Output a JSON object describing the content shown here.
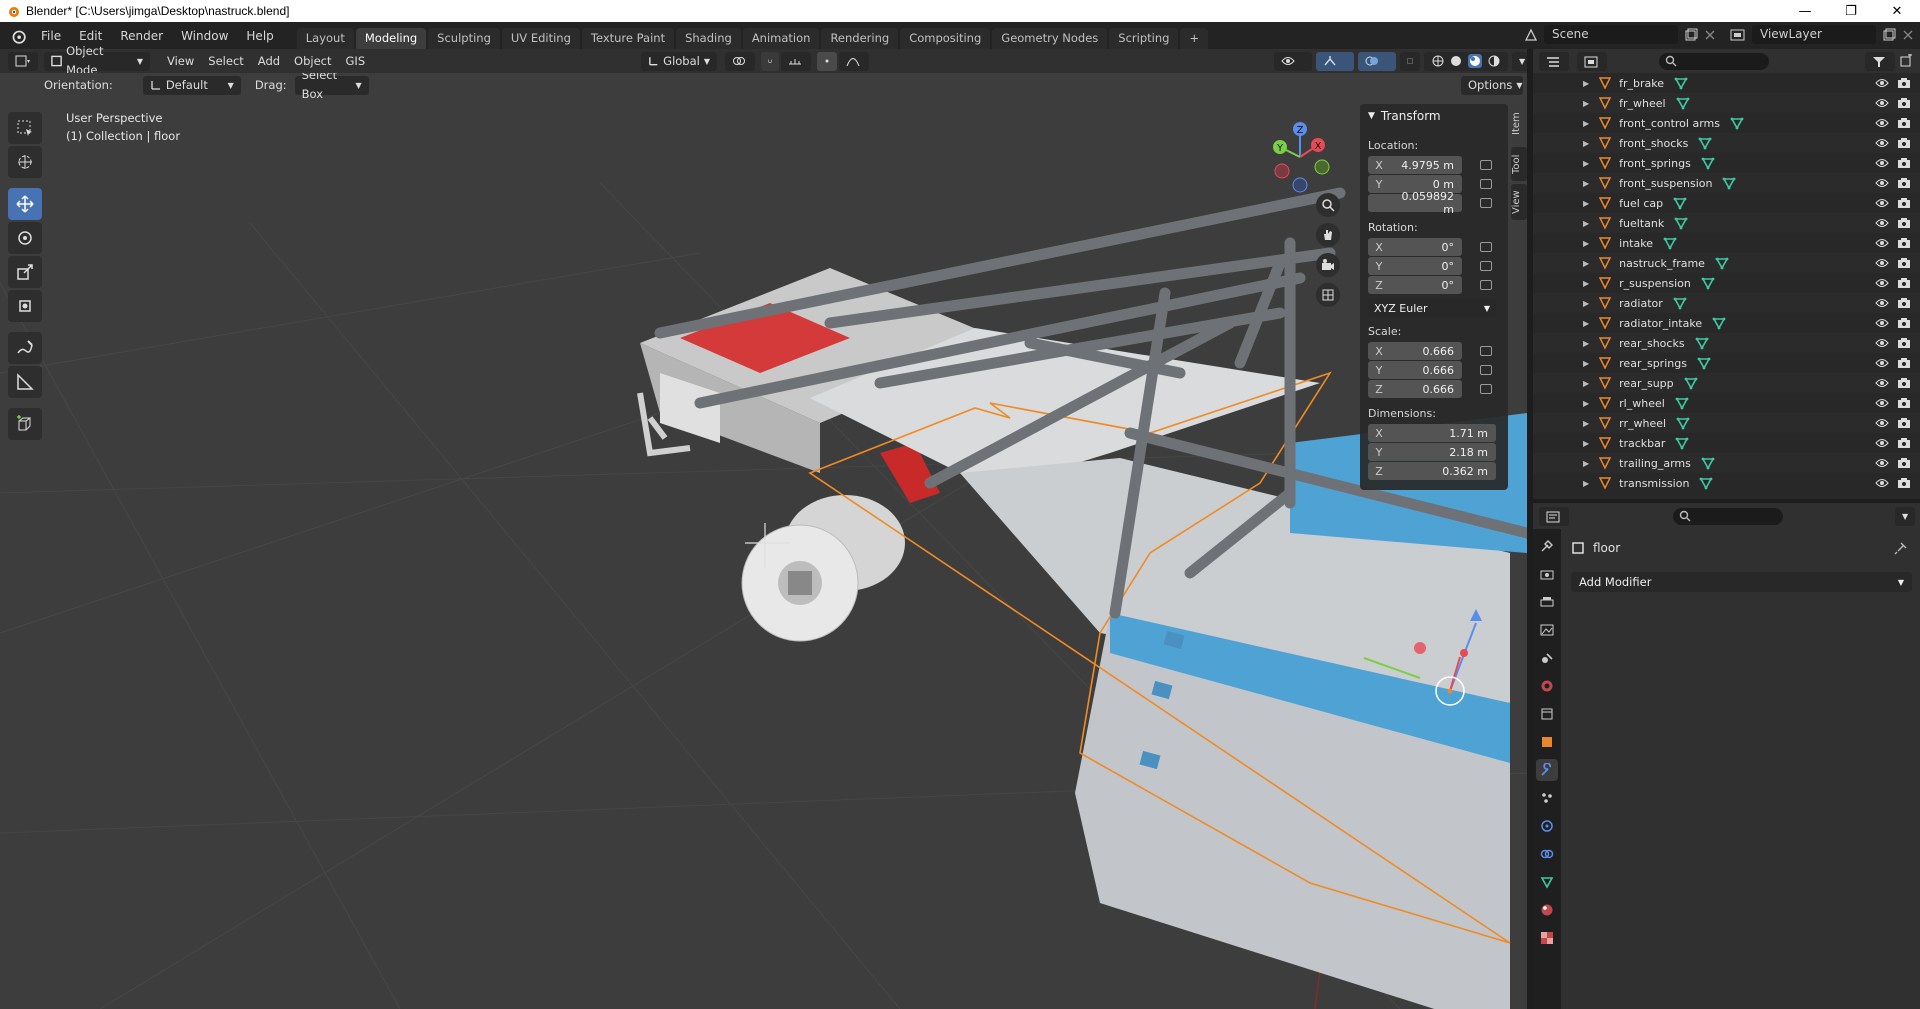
{
  "window": {
    "title": "Blender* [C:\\Users\\jimga\\Desktop\\nastruck.blend]",
    "minimize": "—",
    "maximize": "❐",
    "close": "✕"
  },
  "menu": [
    "File",
    "Edit",
    "Render",
    "Window",
    "Help"
  ],
  "workspaces": [
    "Layout",
    "Modeling",
    "Sculpting",
    "UV Editing",
    "Texture Paint",
    "Shading",
    "Animation",
    "Rendering",
    "Compositing",
    "Geometry Nodes",
    "Scripting"
  ],
  "active_workspace": "Modeling",
  "add_workspace": "+",
  "scene": {
    "label": "Scene",
    "viewlayer": "ViewLayer"
  },
  "header3d": {
    "mode": "Object Mode",
    "menus": [
      "View",
      "Select",
      "Add",
      "Object",
      "GIS"
    ],
    "transform_orientation": "Global"
  },
  "tool_settings": {
    "orientation_label": "Orientation:",
    "orientation_value": "Default",
    "drag_label": "Drag:",
    "drag_value": "Select Box",
    "options": "Options"
  },
  "viewport": {
    "perspective": "User Perspective",
    "collection_info": "(1) Collection | floor"
  },
  "transform": {
    "title": "Transform",
    "location_label": "Location:",
    "location": [
      {
        "axis": "X",
        "value": "4.9795 m"
      },
      {
        "axis": "Y",
        "value": "0 m"
      },
      {
        "axis": "",
        "value": "0.059892 m"
      }
    ],
    "rotation_label": "Rotation:",
    "rotation": [
      {
        "axis": "X",
        "value": "0°"
      },
      {
        "axis": "Y",
        "value": "0°"
      },
      {
        "axis": "Z",
        "value": "0°"
      }
    ],
    "rotation_mode": "XYZ Euler",
    "scale_label": "Scale:",
    "scale": [
      {
        "axis": "X",
        "value": "0.666"
      },
      {
        "axis": "Y",
        "value": "0.666"
      },
      {
        "axis": "Z",
        "value": "0.666"
      }
    ],
    "dimensions_label": "Dimensions:",
    "dimensions": [
      {
        "axis": "X",
        "value": "1.71 m"
      },
      {
        "axis": "Y",
        "value": "2.18 m"
      },
      {
        "axis": "Z",
        "value": "0.362 m"
      }
    ]
  },
  "sidebar_tabs": [
    "Item",
    "Tool",
    "View"
  ],
  "outliner_items": [
    "fr_brake",
    "fr_wheel",
    "front_control arms",
    "front_shocks",
    "front_springs",
    "front_suspension",
    "fuel cap",
    "fueltank",
    "intake",
    "nastruck_frame",
    "r_suspension",
    "radiator",
    "radiator_intake",
    "rear_shocks",
    "rear_springs",
    "rear_supp",
    "rl_wheel",
    "rr_wheel",
    "trackbar",
    "trailing_arms",
    "transmission"
  ],
  "properties": {
    "object_name": "floor",
    "add_modifier": "Add Modifier"
  },
  "gizmo_axes": {
    "x": "X",
    "y": "Y",
    "z": "Z"
  },
  "colors": {
    "accent": "#4772b3",
    "selection_outline": "#f08a24",
    "body_blue": "#4fa3d4",
    "seat_red": "#d43a3a"
  }
}
